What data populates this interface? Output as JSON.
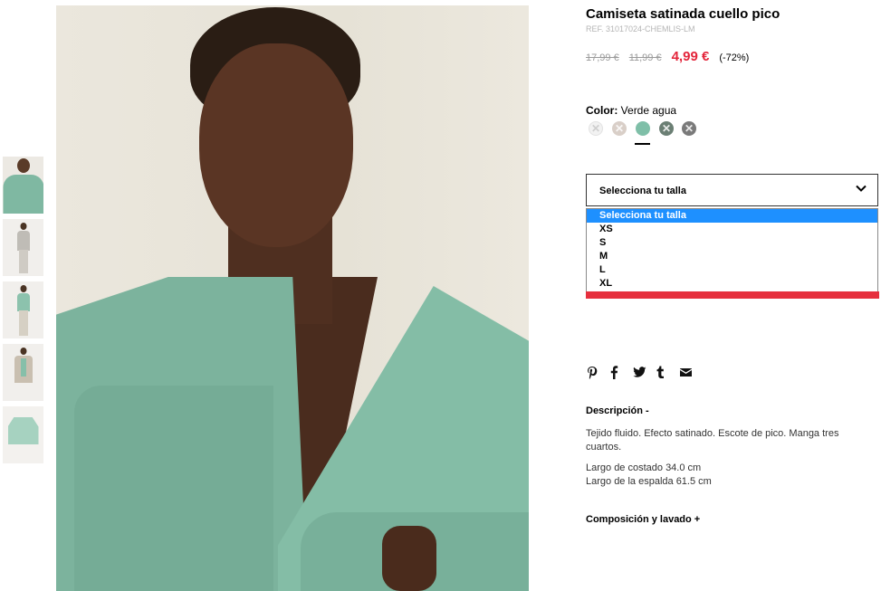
{
  "product": {
    "title": "Camiseta satinada cuello pico",
    "ref": "REF. 31017024-CHEMLIS-LM",
    "price_original": "17,99 €",
    "price_previous": "11,99 €",
    "price_current": "4,99 €",
    "discount": "(-72%)"
  },
  "color": {
    "label": "Color:",
    "value": "Verde agua",
    "swatches": [
      {
        "name": "white",
        "hex": "#f2f2f2",
        "available": false
      },
      {
        "name": "beige",
        "hex": "#d9cfc8",
        "available": false
      },
      {
        "name": "verde-agua",
        "hex": "#7fbfa8",
        "available": true,
        "selected": true
      },
      {
        "name": "dark-green",
        "hex": "#6b7f74",
        "available": false
      },
      {
        "name": "grey",
        "hex": "#7a7a7a",
        "available": false
      }
    ]
  },
  "size": {
    "select_label": "Selecciona tu talla",
    "options": [
      "Selecciona tu talla",
      "XS",
      "S",
      "M",
      "L",
      "XL"
    ],
    "highlighted_index": 0
  },
  "social": {
    "icons": [
      "pinterest-icon",
      "facebook-icon",
      "twitter-icon",
      "tumblr-icon",
      "email-icon"
    ]
  },
  "description": {
    "heading": "Descripción -",
    "text": "Tejido fluido. Efecto satinado. Escote de pico. Manga tres cuartos.",
    "measure_1": "Largo de costado 34.0 cm",
    "measure_2": "Largo de la espalda 61.5 cm"
  },
  "composition": {
    "heading": "Composición y lavado +"
  },
  "colors": {
    "sale_red": "#e3243a",
    "highlight_blue": "#1e90ff",
    "accent_bar": "#e6303e"
  }
}
